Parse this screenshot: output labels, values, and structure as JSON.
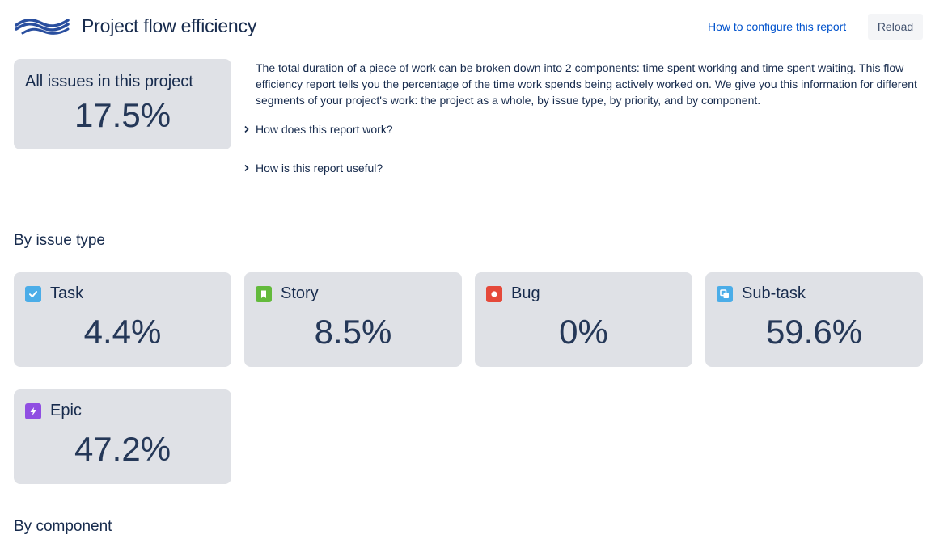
{
  "header": {
    "title": "Project flow efficiency",
    "config_link": "How to configure this report",
    "reload_label": "Reload",
    "logo_icon": "waves-logo-icon"
  },
  "summary": {
    "label": "All issues in this project",
    "value": "17.5%",
    "description": "The total duration of a piece of work can be broken down into 2 components: time spent working and time spent waiting. This flow efficiency report tells you the percentage of the time work spends being actively worked on. We give you this information for different segments of your project's work: the project as a whole, by issue type, by priority, and by component.",
    "expanders": [
      {
        "label": "How does this report work?",
        "icon": "chevron-right-icon"
      },
      {
        "label": "How is this report useful?",
        "icon": "chevron-right-icon"
      }
    ]
  },
  "sections": {
    "by_issue_type": "By issue type",
    "by_component": "By component"
  },
  "issue_types": [
    {
      "label": "Task",
      "value": "4.4%",
      "icon": "task-icon",
      "color": "#4bade8"
    },
    {
      "label": "Story",
      "value": "8.5%",
      "icon": "story-icon",
      "color": "#63ba3c"
    },
    {
      "label": "Bug",
      "value": "0%",
      "icon": "bug-icon",
      "color": "#e5493a"
    },
    {
      "label": "Sub-task",
      "value": "59.6%",
      "icon": "subtask-icon",
      "color": "#4bade8"
    },
    {
      "label": "Epic",
      "value": "47.2%",
      "icon": "epic-icon",
      "color": "#904ee2"
    }
  ],
  "colors": {
    "card_bg": "#dfe1e6",
    "text": "#172b4d",
    "link": "#0052cc",
    "logo": "#2a4f9f"
  }
}
